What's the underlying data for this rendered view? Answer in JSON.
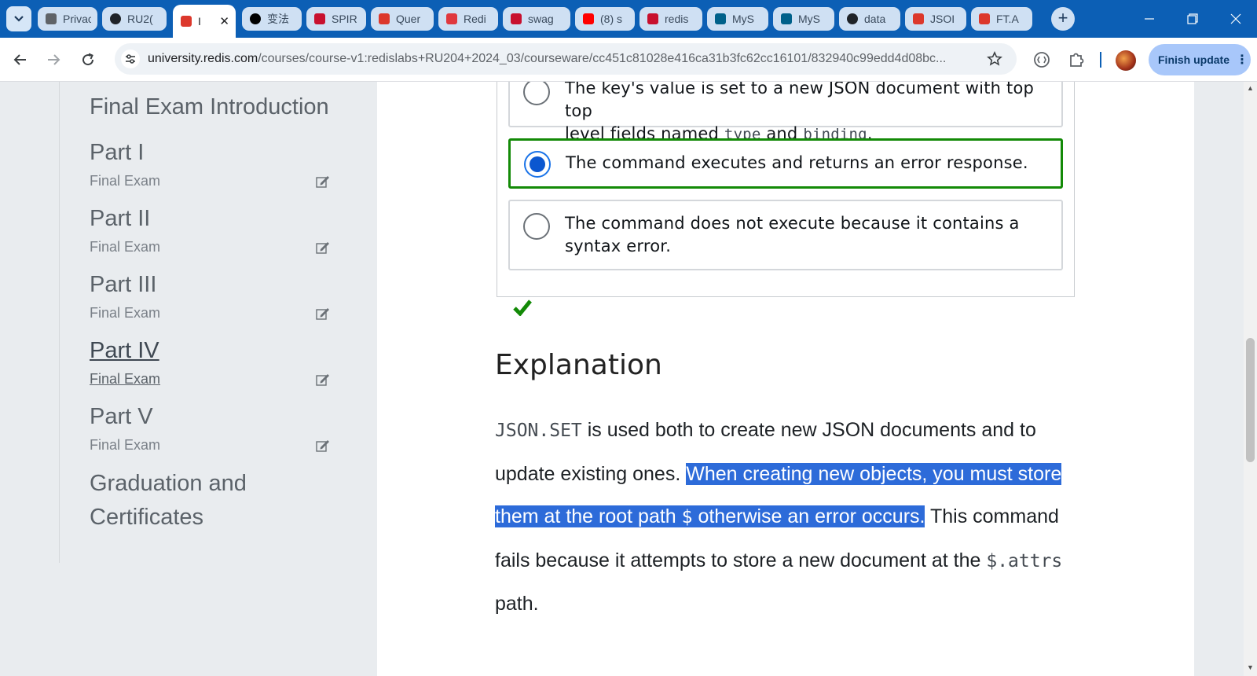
{
  "browser": {
    "tabs": [
      {
        "title": "Privacy a",
        "icon": "privacy-icon",
        "color": "#5f6368"
      },
      {
        "title": "RU2(",
        "icon": "github-icon",
        "color": "#1f2328"
      },
      {
        "title": "I",
        "icon": "redis-cube-icon",
        "color": "#dc382c",
        "active": true
      },
      {
        "title": "变法",
        "icon": "chat-bot-icon",
        "color": "#000000"
      },
      {
        "title": "SPIR",
        "icon": "crest-icon",
        "color": "#c8102e"
      },
      {
        "title": "Quer",
        "icon": "redis-cube-icon",
        "color": "#dc382c"
      },
      {
        "title": "Redi",
        "icon": "redis-logo-icon",
        "color": "#e0383e"
      },
      {
        "title": "swag",
        "icon": "swag-icon",
        "color": "#c8102e"
      },
      {
        "title": "(8) s",
        "icon": "youtube-icon",
        "color": "#ff0000"
      },
      {
        "title": "redis",
        "icon": "swag-icon",
        "color": "#c8102e"
      },
      {
        "title": "MyS",
        "icon": "mysql-icon",
        "color": "#00618a"
      },
      {
        "title": "MyS",
        "icon": "mysql-icon",
        "color": "#00618a"
      },
      {
        "title": "data",
        "icon": "github-icon",
        "color": "#1f2328"
      },
      {
        "title": "JSOI",
        "icon": "redis-cube-icon",
        "color": "#dc382c"
      },
      {
        "title": "FT.A",
        "icon": "redis-cube-icon",
        "color": "#dc382c"
      }
    ],
    "url_host": "university.redis.com",
    "url_path": "/courses/course-v1:redislabs+RU204+2024_03/courseware/cc451c81028e416ca31b3fc62cc16101/832940c99edd4d08bc...",
    "finish_update": "Finish update",
    "accent": "#0c5fb5"
  },
  "sidebar": {
    "intro": "Final Exam Introduction",
    "parts": [
      {
        "title": "Part I",
        "sub": "Final Exam",
        "current": false
      },
      {
        "title": "Part II",
        "sub": "Final Exam",
        "current": false
      },
      {
        "title": "Part III",
        "sub": "Final Exam",
        "current": false
      },
      {
        "title": "Part IV",
        "sub": "Final Exam",
        "current": true
      },
      {
        "title": "Part V",
        "sub": "Final Exam",
        "current": false
      }
    ],
    "graduation": "Graduation and Certificates"
  },
  "question": {
    "option_a_line1": "The key's value is set to a new JSON document with top top",
    "option_a_line2_pre": "level fields named ",
    "option_a_code1": "type",
    "option_a_mid": " and ",
    "option_a_code2": "binding",
    "option_a_end": ".",
    "option_b": "The command executes and returns an error response.",
    "option_c": "The command does not execute because it contains a syntax error.",
    "selected": "option_b",
    "correct_color": "#138a07"
  },
  "explanation": {
    "title": "Explanation",
    "code1": "JSON.SET",
    "text1": " is used both to create new JSON documents and to update existing ones. ",
    "highlight1": "When creating new objects, you must store them at the root path ",
    "code2": "$",
    "highlight2": " otherwise an error occurs.",
    "text2": " This command fails because it attempts to store a new document at the ",
    "code3": "$.attrs",
    "text3": " path."
  }
}
